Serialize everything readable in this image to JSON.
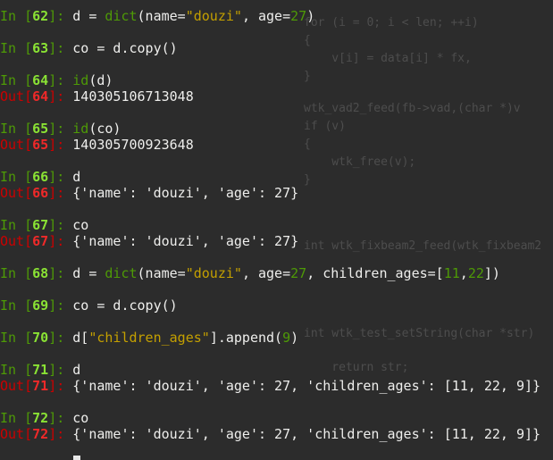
{
  "prompts": {
    "in_label": "In [",
    "out_label": "Out[",
    "close": "]: "
  },
  "cells": [
    {
      "num": "62",
      "input": [
        {
          "t": "d = ",
          "c": "code"
        },
        {
          "t": "dict",
          "c": "kw"
        },
        {
          "t": "(name=",
          "c": "code"
        },
        {
          "t": "\"douzi\"",
          "c": "str"
        },
        {
          "t": ", age=",
          "c": "code"
        },
        {
          "t": "27",
          "c": "num"
        },
        {
          "t": ")",
          "c": "code"
        }
      ],
      "output": null
    },
    {
      "num": "63",
      "input": [
        {
          "t": "co = d.copy()",
          "c": "code"
        }
      ],
      "output": null
    },
    {
      "num": "64",
      "input": [
        {
          "t": "id",
          "c": "kw"
        },
        {
          "t": "(d)",
          "c": "code"
        }
      ],
      "output": "140305106713048"
    },
    {
      "num": "65",
      "input": [
        {
          "t": "id",
          "c": "kw"
        },
        {
          "t": "(co)",
          "c": "code"
        }
      ],
      "output": "140305700923648"
    },
    {
      "num": "66",
      "input": [
        {
          "t": "d",
          "c": "code"
        }
      ],
      "output": "{'name': 'douzi', 'age': 27}"
    },
    {
      "num": "67",
      "input": [
        {
          "t": "co",
          "c": "code"
        }
      ],
      "output": "{'name': 'douzi', 'age': 27}"
    },
    {
      "num": "68",
      "input": [
        {
          "t": "d = ",
          "c": "code"
        },
        {
          "t": "dict",
          "c": "kw"
        },
        {
          "t": "(name=",
          "c": "code"
        },
        {
          "t": "\"douzi\"",
          "c": "str"
        },
        {
          "t": ", age=",
          "c": "code"
        },
        {
          "t": "27",
          "c": "num"
        },
        {
          "t": ", children_ages=[",
          "c": "code"
        },
        {
          "t": "11",
          "c": "num"
        },
        {
          "t": ",",
          "c": "code"
        },
        {
          "t": "22",
          "c": "num"
        },
        {
          "t": "])",
          "c": "code"
        }
      ],
      "output": null
    },
    {
      "num": "69",
      "input": [
        {
          "t": "co = d.copy()",
          "c": "code"
        }
      ],
      "output": null
    },
    {
      "num": "70",
      "input": [
        {
          "t": "d[",
          "c": "code"
        },
        {
          "t": "\"children_ages\"",
          "c": "str"
        },
        {
          "t": "].append(",
          "c": "code"
        },
        {
          "t": "9",
          "c": "num"
        },
        {
          "t": ")",
          "c": "code"
        }
      ],
      "output": null
    },
    {
      "num": "71",
      "input": [
        {
          "t": "d",
          "c": "code"
        }
      ],
      "output": "{'name': 'douzi', 'age': 27, 'children_ages': [11, 22, 9]}"
    },
    {
      "num": "72",
      "input": [
        {
          "t": "co",
          "c": "code"
        }
      ],
      "output": "{'name': 'douzi', 'age': 27, 'children_ages': [11, 22, 9]}"
    }
  ],
  "colors": {
    "background": "#2c2c2c",
    "in_prompt": "#4e9a06",
    "out_prompt": "#cc0000",
    "string": "#c4a000",
    "text": "#eeeeec"
  }
}
